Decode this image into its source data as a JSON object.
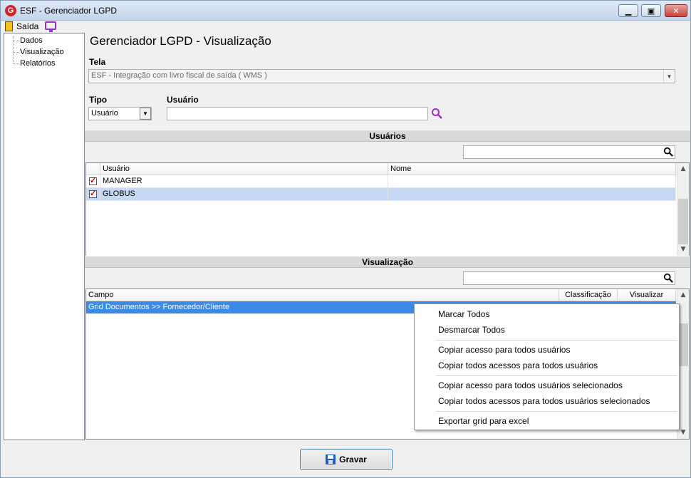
{
  "window": {
    "title": "ESF - Gerenciador LGPD",
    "app_icon_letter": "G",
    "minimize_glyph": "▁",
    "maximize_glyph": "▣",
    "close_glyph": "✕"
  },
  "menubar": {
    "exit_label": "Saída",
    "exit_icon": "door-exit-icon",
    "monitor_icon": "monitor-icon"
  },
  "sidebar": {
    "items": [
      {
        "label": "Dados"
      },
      {
        "label": "Visualização"
      },
      {
        "label": "Relatórios"
      }
    ]
  },
  "main": {
    "title": "Gerenciador LGPD - Visualização",
    "tela_label": "Tela",
    "tela_value": "ESF - Integração com livro fiscal de saída ( WMS )",
    "tipo_label": "Tipo",
    "tipo_value": "Usuário",
    "usuario_label": "Usuário",
    "usuario_value": ""
  },
  "users_section": {
    "header": "Usuários",
    "filter_value": "",
    "columns": [
      "Usuário",
      "Nome"
    ],
    "rows": [
      {
        "checked": true,
        "usuario": "MANAGER",
        "nome": ""
      },
      {
        "checked": true,
        "usuario": "GLOBUS",
        "nome": ""
      }
    ]
  },
  "visual_section": {
    "header": "Visualização",
    "filter_value": "",
    "columns": [
      "Campo",
      "Classificação",
      "Visualizar"
    ],
    "rows": [
      {
        "campo": "Grid Documentos >> Fornecedor/Cliente",
        "classificacao": "",
        "visualizar": ""
      }
    ]
  },
  "context_menu": {
    "items": [
      "Marcar Todos",
      "Desmarcar Todos",
      "Copiar acesso para todos usuários",
      "Copiar todos acessos para todos usuários",
      "Copiar acesso para todos usuários selecionados",
      "Copiar todos acessos para todos usuários selecionados",
      "Exportar grid para excel"
    ]
  },
  "footer": {
    "save_label": "Gravar",
    "save_icon": "floppy-disk-icon"
  },
  "colors": {
    "selected_row": "#c7d8f4",
    "highlight_row": "#3b8ae6",
    "check_mark": "#c00000",
    "search_icon": "#9b2fc9"
  }
}
